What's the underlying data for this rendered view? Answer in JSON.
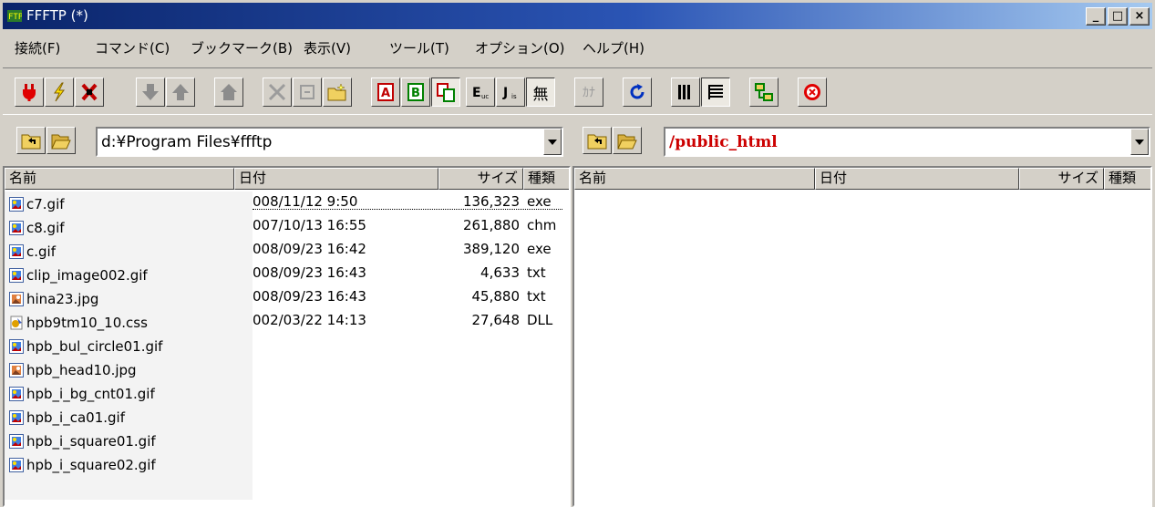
{
  "title": "FFFTP (*)",
  "window_controls": {
    "minimize": "_",
    "maximize": "□",
    "close": "×"
  },
  "menu": [
    "接続(F)",
    "コマンド(C)",
    "ブックマーク(B)",
    "表示(V)",
    "ツール(T)",
    "オプション(O)",
    "ヘルプ(H)"
  ],
  "toolbar": {
    "connect": "connect-icon",
    "quick_connect": "lightning-icon",
    "disconnect": "disconnect-icon",
    "download": "down-arrow-icon",
    "upload": "up-arrow-icon",
    "mirror_upload": "house-icon",
    "delete": "delete-icon",
    "rename": "rename-icon",
    "mkdir": "new-folder-icon",
    "mode_ascii": "A",
    "mode_binary": "B",
    "mode_auto": "auto-mode-icon",
    "kanji_euc": "E",
    "kanji_jis": "J",
    "kanji_none": "無",
    "kana": "ｶﾅ",
    "refresh": "refresh-icon",
    "list_view": "list-icon",
    "detail_view": "detail-icon",
    "tree_view": "tree-icon",
    "stop": "stop-icon"
  },
  "local": {
    "path": "d:¥Program Files¥ffftp",
    "headers": {
      "name": "名前",
      "date": "日付",
      "size": "サイズ",
      "type": "種類"
    },
    "files": [
      {
        "name": "c7.gif",
        "date": "008/11/12  9:50",
        "size": "136,323",
        "type": "exe",
        "kind": "gif"
      },
      {
        "name": "c8.gif",
        "date": "007/10/13 16:55",
        "size": "261,880",
        "type": "chm",
        "kind": "gif"
      },
      {
        "name": "c.gif",
        "date": "008/09/23 16:42",
        "size": "389,120",
        "type": "exe",
        "kind": "gif"
      },
      {
        "name": "clip_image002.gif",
        "date": "008/09/23 16:43",
        "size": "4,633",
        "type": "txt",
        "kind": "gif"
      },
      {
        "name": "hina23.jpg",
        "date": "008/09/23 16:43",
        "size": "45,880",
        "type": "txt",
        "kind": "jpg"
      },
      {
        "name": "hpb9tm10_10.css",
        "date": "002/03/22 14:13",
        "size": "27,648",
        "type": "DLL",
        "kind": "css"
      },
      {
        "name": "hpb_bul_circle01.gif",
        "kind": "gif"
      },
      {
        "name": "hpb_head10.jpg",
        "kind": "jpg"
      },
      {
        "name": "hpb_i_bg_cnt01.gif",
        "kind": "gif"
      },
      {
        "name": "hpb_i_ca01.gif",
        "kind": "gif"
      },
      {
        "name": "hpb_i_square01.gif",
        "kind": "gif"
      },
      {
        "name": "hpb_i_square02.gif",
        "kind": "gif"
      }
    ]
  },
  "remote": {
    "path": "/public_html",
    "path_color": "#cc0000",
    "headers": {
      "name": "名前",
      "date": "日付",
      "size": "サイズ",
      "type": "種類"
    }
  }
}
